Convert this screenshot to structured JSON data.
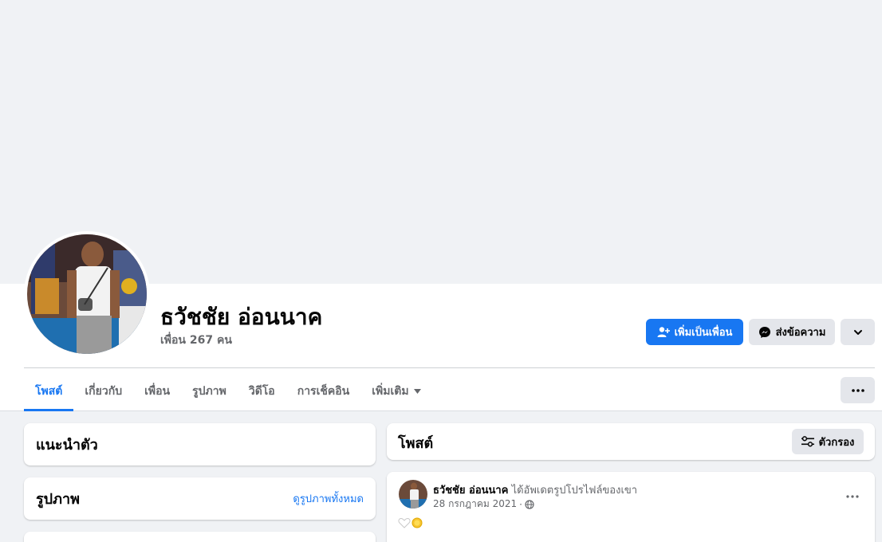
{
  "profile": {
    "name": "ธวัชชัย อ่อนนาค",
    "friends_text": "เพื่อน 267 คน"
  },
  "actions": {
    "add_friend": "เพิ่มเป็นเพื่อน",
    "message": "ส่งข้อความ"
  },
  "tabs": [
    {
      "label": "โพสต์"
    },
    {
      "label": "เกี่ยวกับ"
    },
    {
      "label": "เพื่อน"
    },
    {
      "label": "รูปภาพ"
    },
    {
      "label": "วิดีโอ"
    },
    {
      "label": "การเช็คอิน"
    },
    {
      "label": "เพิ่มเติม"
    }
  ],
  "intro_card": {
    "title": "แนะนำตัว"
  },
  "photos_card": {
    "title": "รูปภาพ",
    "see_all": "ดูรูปภาพทั้งหมด"
  },
  "posts_header": {
    "title": "โพสต์",
    "filter_label": "ตัวกรอง"
  },
  "post": {
    "author": "ธวัชชัย อ่อนนาค",
    "action_text": "ได้อัพเดตรูปโปรไฟล์ของเขา",
    "date": "28 กรกฎาคม 2021",
    "separator": "·"
  },
  "colors": {
    "accent": "#1877f2",
    "secondary_bg": "#e4e6eb",
    "page_bg": "#f0f2f5"
  }
}
